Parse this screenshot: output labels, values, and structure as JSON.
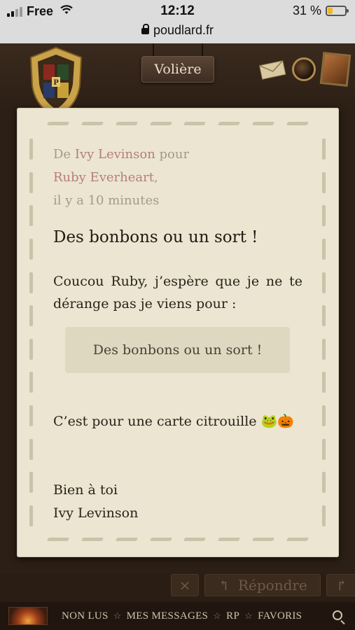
{
  "status": {
    "carrier": "Free",
    "time": "12:12",
    "battery_pct": "31 %",
    "battery_fill": 0.31,
    "url": "poudlard.fr"
  },
  "header": {
    "title_button": "Volière",
    "icons": [
      "crest-icon",
      "envelope-icon",
      "crystal-ball-icon",
      "portrait-icon"
    ]
  },
  "letter": {
    "from_prefix": "De",
    "sender": "Ivy Levinson",
    "to_prefix": "pour",
    "recipient": "Ruby Everheart",
    "recipient_suffix": ",",
    "time": "il y a 10 minutes",
    "subject": "Des bonbons ou un sort !",
    "body_intro": "Coucou Ruby, j’espère que je ne te dérange pas je viens pour :",
    "quote": "Des bonbons ou un sort !",
    "body_card": "C’est pour une carte citrouille 🐸🎃",
    "closing": "Bien à toi",
    "signature": "Ivy Levinson"
  },
  "actions": {
    "reply_label": "Répondre",
    "close_icon": "×"
  },
  "nav": {
    "items": [
      "NON LUS",
      "MES MESSAGES",
      "RP",
      "FAVORIS"
    ]
  }
}
